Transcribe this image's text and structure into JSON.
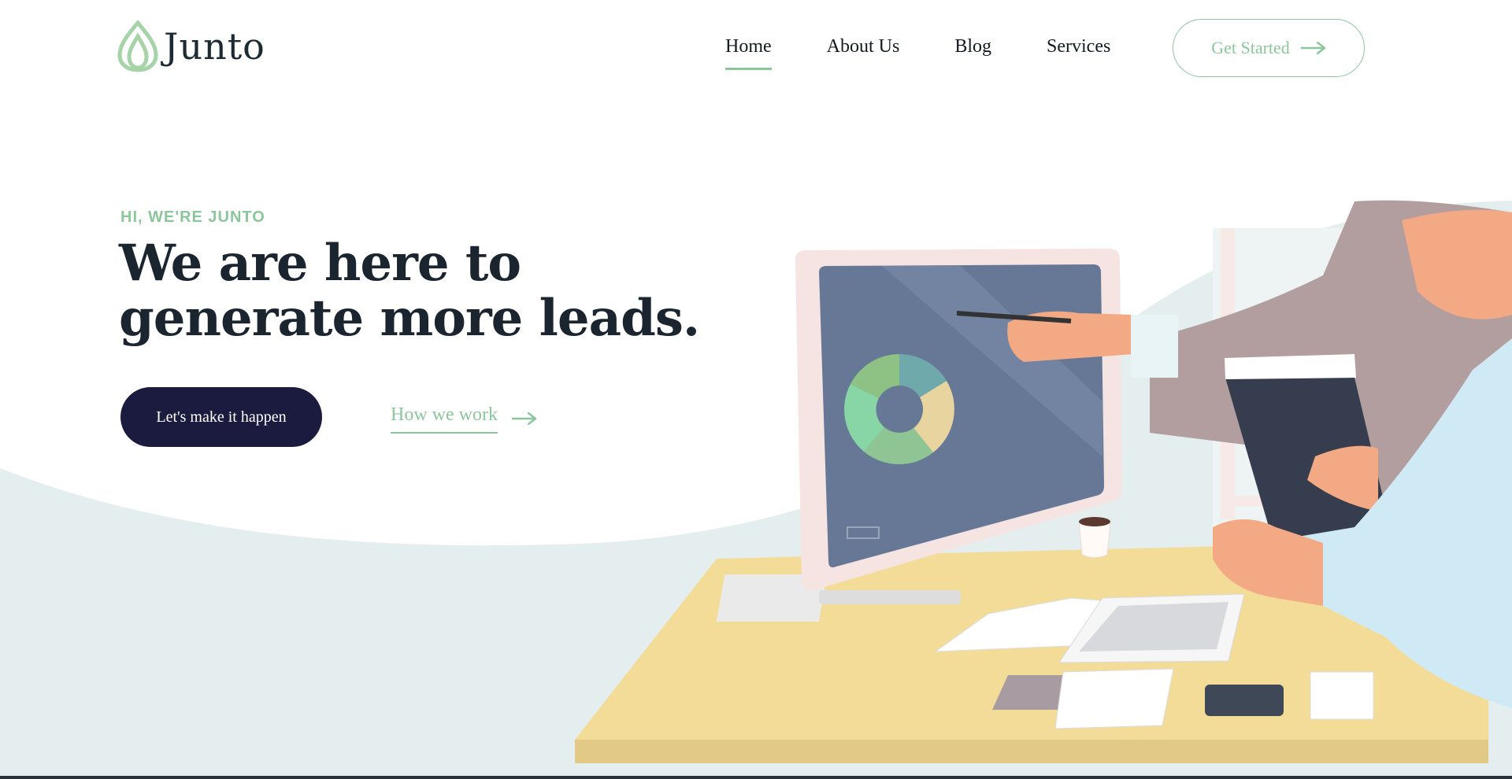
{
  "brand": {
    "name": "Junto",
    "logo_icon": "leaf-drop-icon",
    "accent": "#8cc79b",
    "dark": "#1b1b3f"
  },
  "nav": {
    "items": [
      {
        "label": "Home",
        "active": true
      },
      {
        "label": "About Us",
        "active": false
      },
      {
        "label": "Blog",
        "active": false
      },
      {
        "label": "Services",
        "active": false
      }
    ],
    "cta_label": "Get Started",
    "cta_icon": "arrow-right-icon"
  },
  "hero": {
    "eyebrow": "HI, WE'RE JUNTO",
    "headline_line1": "We are here to",
    "headline_line2": "generate more leads.",
    "primary_button": "Let's make it happen",
    "secondary_link": "How we work",
    "secondary_icon": "arrow-right-icon",
    "illustration": "office-team-at-computer-illustration"
  }
}
